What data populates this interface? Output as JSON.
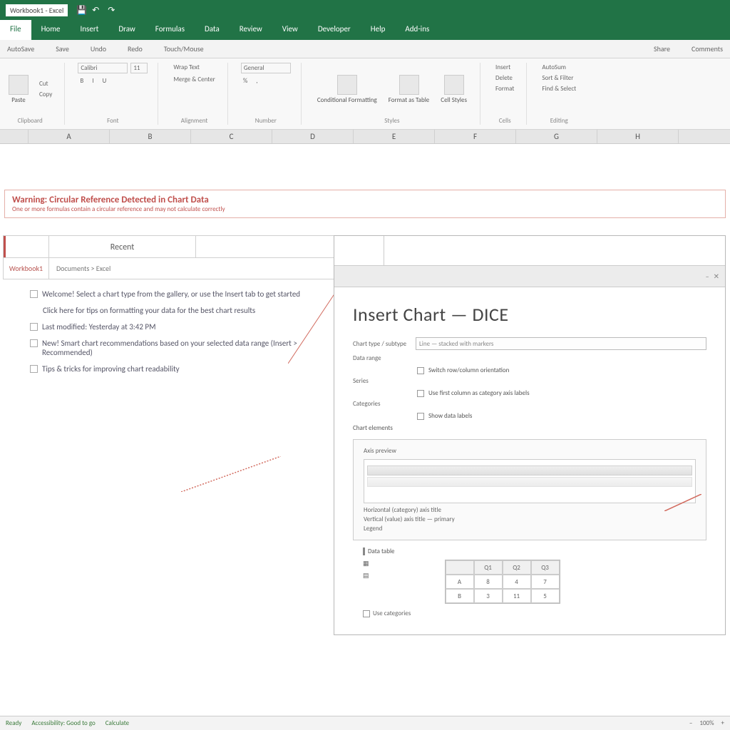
{
  "titlebar": {
    "doc": "Workbook1 - Excel"
  },
  "tabs": [
    "File",
    "Home",
    "Insert",
    "Draw",
    "Formulas",
    "Data",
    "Review",
    "View",
    "Developer",
    "Help",
    "Add-ins"
  ],
  "activeTab": 0,
  "subribbon": [
    "AutoSave",
    "Save",
    "Undo",
    "Redo",
    "Touch/Mouse",
    "Share",
    "Comments"
  ],
  "ribbonGroups": [
    {
      "label": "Clipboard",
      "items": [
        "Paste",
        "Cut",
        "Copy"
      ]
    },
    {
      "label": "Font",
      "items": [
        "Calibri",
        "11",
        "B",
        "I",
        "U"
      ]
    },
    {
      "label": "Alignment",
      "items": [
        "Wrap Text",
        "Merge & Center"
      ]
    },
    {
      "label": "Number",
      "items": [
        "General",
        "%",
        ","
      ]
    },
    {
      "label": "Styles",
      "items": [
        "Conditional Formatting",
        "Format as Table",
        "Cell Styles"
      ]
    },
    {
      "label": "Cells",
      "items": [
        "Insert",
        "Delete",
        "Format"
      ]
    },
    {
      "label": "Editing",
      "items": [
        "AutoSum",
        "Sort & Filter",
        "Find & Select"
      ]
    }
  ],
  "columns": [
    "",
    "A",
    "B",
    "C",
    "D",
    "E",
    "F",
    "G",
    "H"
  ],
  "warning": {
    "title": "Warning: Circular Reference Detected in Chart Data",
    "sub": "One or more formulas contain a circular reference and may not calculate correctly"
  },
  "leftPane": {
    "headerTab": "Recent",
    "row2a": "Workbook1",
    "row2b": "Documents > Excel",
    "items": [
      "Welcome! Select a chart type from the gallery, or use the Insert tab to get started",
      "Click here for tips on formatting your data for the best chart results",
      "Last modified: Yesterday at 3:42 PM",
      "New! Smart chart recommendations based on your selected data range (Insert > Recommended)",
      "Tips & tricks for improving chart readability"
    ]
  },
  "dialog": {
    "title": "Insert  Chart — DICE",
    "fields": {
      "chartType": {
        "label": "Chart type / subtype",
        "value": "Line — stacked with markers"
      },
      "dataRange": {
        "label": "Data range",
        "value": ""
      },
      "series": {
        "label": "Series",
        "value": ""
      },
      "categories": {
        "label": "Categories",
        "value": ""
      }
    },
    "checks": [
      "Switch row/column orientation",
      "Use first column as category axis labels",
      "Show data labels"
    ],
    "innerHeader": "Chart elements",
    "innerLabel": "Axis preview",
    "innerFoot1": "Horizontal (category) axis title",
    "innerFoot2": "Vertical (value) axis title — primary",
    "innerFoot3": "Legend",
    "bottomLabel": "Data table",
    "miniTable": {
      "headers": [
        "",
        "Q1",
        "Q2",
        "Q3"
      ],
      "rows": [
        [
          "A",
          "8",
          "4",
          "7"
        ],
        [
          "B",
          "3",
          "11",
          "5"
        ]
      ]
    },
    "catLabel": "Use categories"
  },
  "statusbar": {
    "left": [
      "Ready",
      "Accessibility: Good to go",
      "Calculate"
    ],
    "right": [
      "100%",
      "–",
      "+"
    ]
  },
  "icons": {
    "dropdown": "▾",
    "close": "✕",
    "min": "–"
  }
}
